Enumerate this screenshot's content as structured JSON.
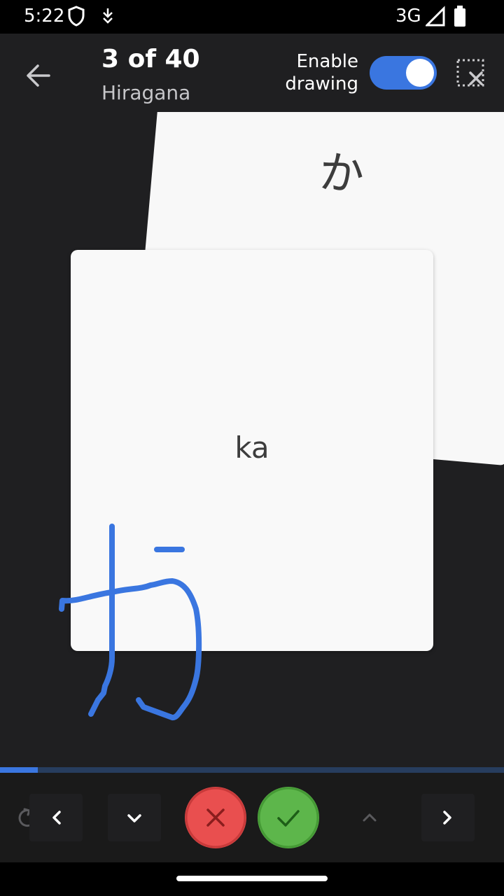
{
  "status_bar": {
    "time": "5:22",
    "network": "3G",
    "icons": [
      "shield-icon",
      "download-icon",
      "signal-icon",
      "battery-icon"
    ]
  },
  "header": {
    "title": "3 of 40",
    "subtitle": "Hiragana",
    "enable_drawing_line1": "Enable",
    "enable_drawing_line2": "drawing",
    "drawing_enabled": true
  },
  "cards": {
    "back_text": "か",
    "front_text": "ka"
  },
  "progress": {
    "current": 3,
    "total": 40,
    "fraction": 0.075
  },
  "colors": {
    "accent": "#3a76e0",
    "wrong": "#e94f4f",
    "right": "#5db64b",
    "background": "#1f1f21",
    "card": "#f9f9f9"
  },
  "bottom_bar": {
    "icons": [
      "undo-icon",
      "chevron-left-icon",
      "chevron-down-icon",
      "close-icon",
      "check-icon",
      "chevron-up-icon",
      "chevron-right-icon"
    ]
  }
}
